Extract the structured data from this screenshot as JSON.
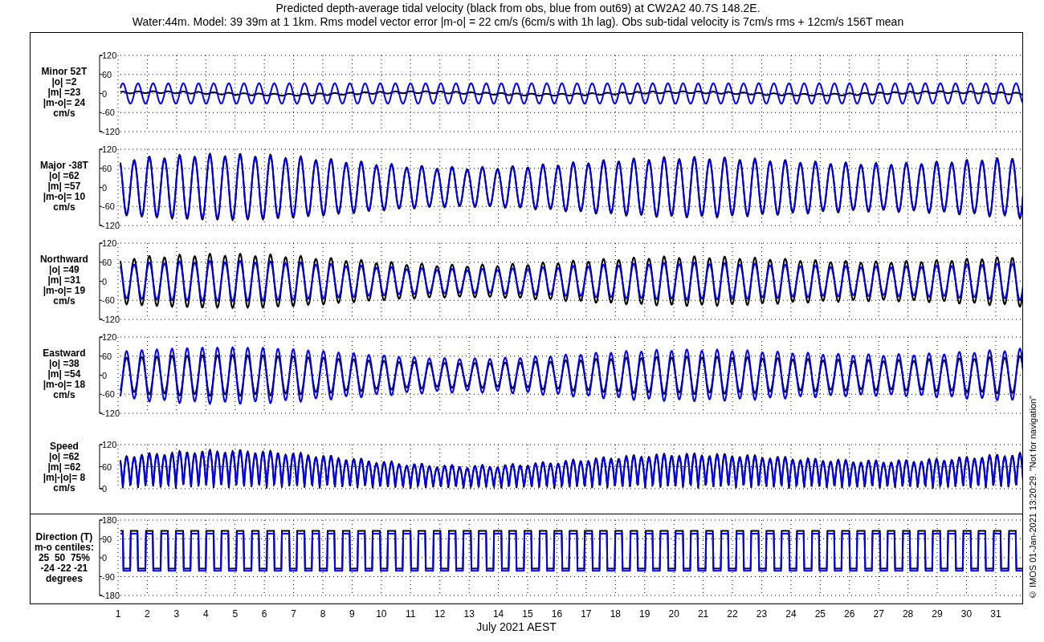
{
  "title": "Predicted depth-average tidal velocity (black from obs, blue from out69) at CW2A2 40.7S 148.2E.",
  "subtitle": "Water:44m. Model: 39 39m at 1 1km. Rms model vector error |m-o| = 22 cm/s (6cm/s with 1h lag). Obs sub-tidal velocity is 7cm/s rms + 12cm/s 156T mean",
  "panels": [
    {
      "kind": "minor",
      "label_lines": [
        "Minor 52T",
        "|o| =2",
        "|m| =23",
        "|m-o|= 24",
        "cm/s"
      ],
      "yticks": [
        "120",
        "60",
        "0",
        "-60",
        "-120"
      ]
    },
    {
      "kind": "major",
      "label_lines": [
        "Major -38T",
        "|o| =62",
        "|m| =57",
        "|m-o|= 10",
        "cm/s"
      ],
      "yticks": [
        "120",
        "60",
        "0",
        "-60",
        "-120"
      ]
    },
    {
      "kind": "northward",
      "label_lines": [
        "Northward",
        "|o| =49",
        "|m| =31",
        "|m-o|= 19",
        "cm/s"
      ],
      "yticks": [
        "120",
        "60",
        "0",
        "-60",
        "-120"
      ]
    },
    {
      "kind": "eastward",
      "label_lines": [
        "Eastward",
        "|o| =38",
        "|m| =54",
        "|m-o|= 18",
        "cm/s"
      ],
      "yticks": [
        "120",
        "60",
        "0",
        "-60",
        "-120"
      ]
    },
    {
      "kind": "speed",
      "label_lines": [
        "Speed",
        "|o| =62",
        "|m| =62",
        "|m|-|o|= 8",
        "cm/s"
      ],
      "yticks": [
        "120",
        "60",
        "0"
      ]
    },
    {
      "kind": "direction",
      "label_lines": [
        "Direction (T)",
        "m-o centiles:",
        "25  50  75%",
        "-24 -22 -21",
        "degrees"
      ],
      "yticks": [
        "180",
        "90",
        "0",
        "-90",
        "-180"
      ]
    }
  ],
  "days": [
    "1",
    "2",
    "3",
    "4",
    "5",
    "6",
    "7",
    "8",
    "9",
    "10",
    "11",
    "12",
    "13",
    "14",
    "15",
    "16",
    "17",
    "18",
    "19",
    "20",
    "21",
    "22",
    "23",
    "24",
    "25",
    "26",
    "27",
    "28",
    "29",
    "30",
    "31"
  ],
  "xlabel": "July 2021 AEST",
  "credit": "© IMOS 01-Jan-2021 13:20:29. \"Not for navigation\""
}
